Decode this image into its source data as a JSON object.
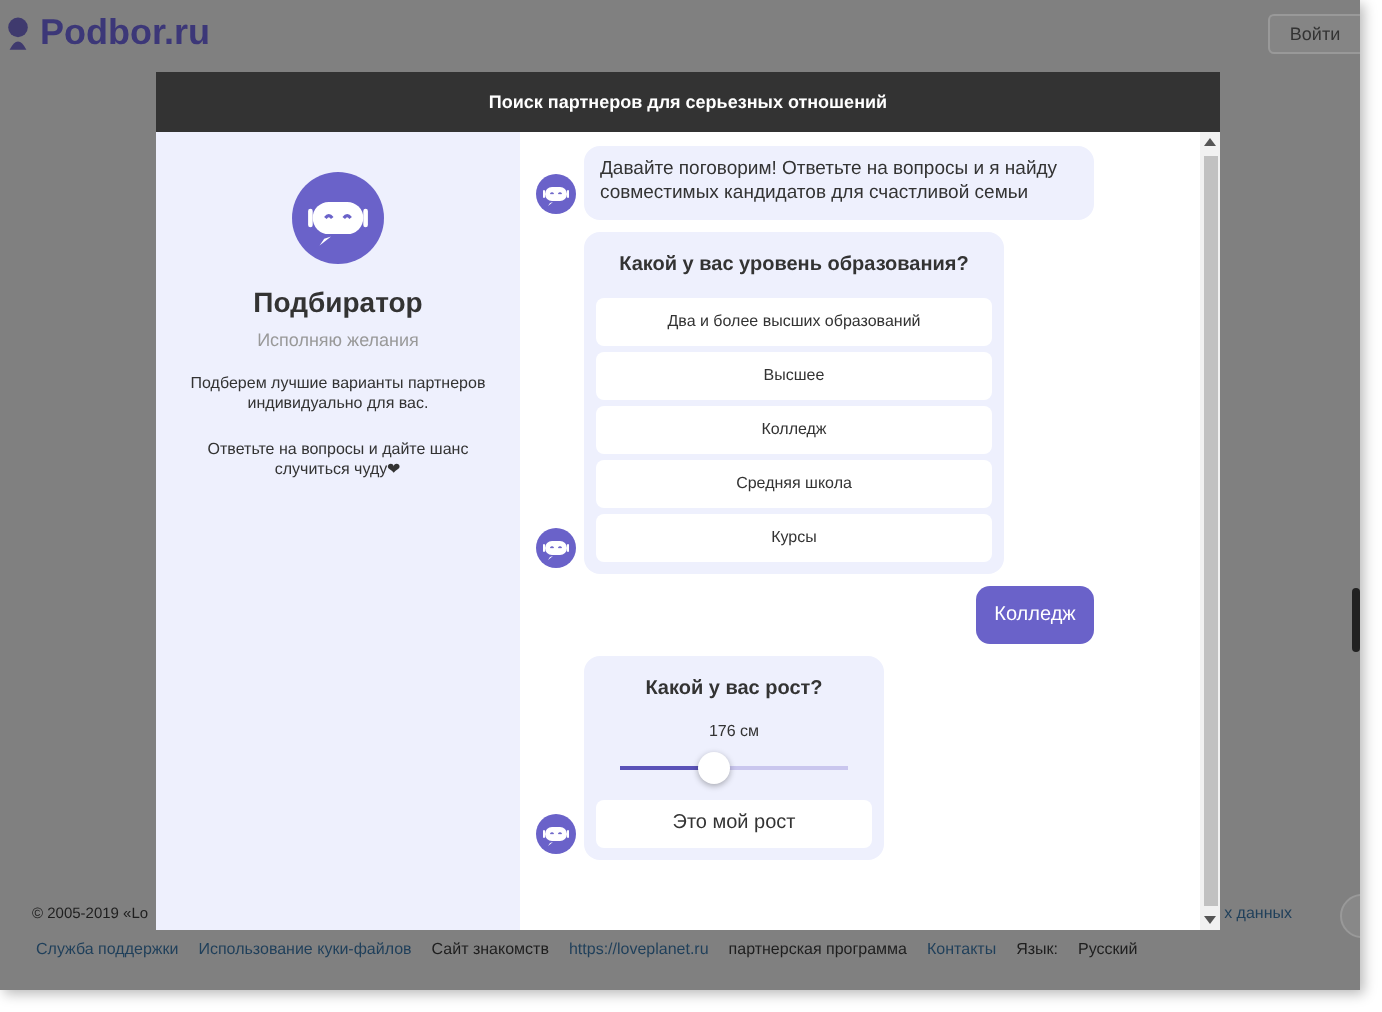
{
  "header": {
    "logo": "Podbor.ru",
    "login_button": "Войти"
  },
  "modal": {
    "title": "Поиск партнеров для серьезных отношений",
    "bot": {
      "name": "Подбиратор",
      "status": "Исполняю желания",
      "intro": [
        "Подберем лучшие варианты партнеров индивидуально для вас.",
        "Ответьте на вопросы и дайте шанс случиться чуду❤"
      ]
    },
    "messages": [
      {
        "kind": "text",
        "text": "Давайте поговорим! Ответьте на вопросы и я найду совместимых кандидатов для счастливой семьи"
      },
      {
        "kind": "choice",
        "question": "Какой у вас уровень образования?",
        "options": [
          {
            "label": "Два и более высших образований",
            "selected": false
          },
          {
            "label": "Высшее",
            "selected": false
          },
          {
            "label": "Колледж",
            "selected": false
          },
          {
            "label": "Средняя школа",
            "selected": false
          },
          {
            "label": "Курсы",
            "selected": false
          }
        ]
      },
      {
        "kind": "answer",
        "text": "Колледж"
      },
      {
        "kind": "slider",
        "question": "Какой у вас рост?",
        "reading": "176 см",
        "level": 0.41,
        "button": "Это мой рост"
      }
    ]
  },
  "footer": {
    "copyright": "© 2005-2019 «Lo",
    "fragment": "х данных",
    "links": [
      {
        "kind": "link",
        "text": "Служба поддержки"
      },
      {
        "kind": "link",
        "text": "Использование куки-файлов"
      },
      {
        "kind": "text",
        "text": "Сайт знакомств"
      },
      {
        "kind": "link",
        "text": "https://loveplanet.ru"
      },
      {
        "kind": "text",
        "text": "партнерская программа"
      },
      {
        "kind": "link",
        "text": "Контакты"
      },
      {
        "kind": "text",
        "text": "Язык:"
      },
      {
        "kind": "text",
        "text": "Русский"
      }
    ]
  }
}
